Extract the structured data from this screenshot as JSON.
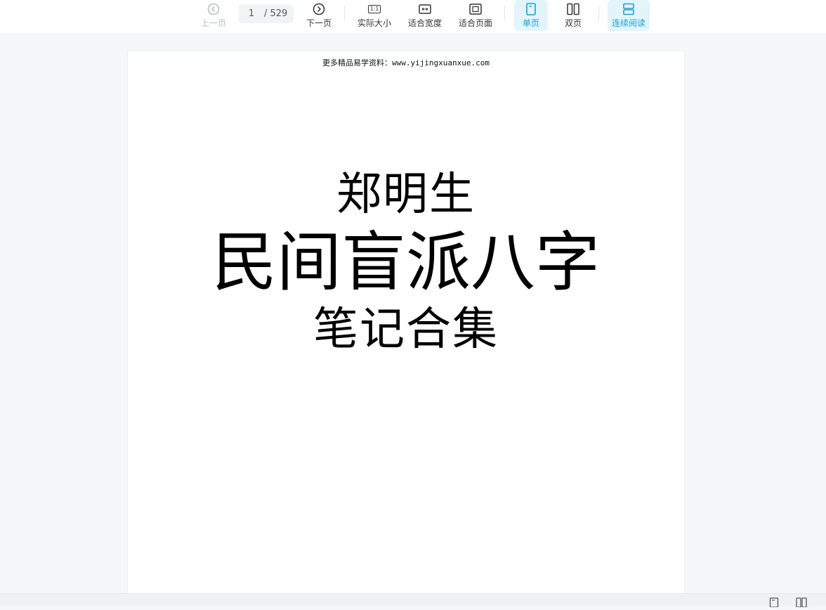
{
  "toolbar": {
    "prev_label": "上一页",
    "next_label": "下一页",
    "page_current": "1",
    "page_total": "/ 529",
    "actual_size_label": "实际大小",
    "fit_width_label": "适合宽度",
    "fit_page_label": "适合页面",
    "single_page_label": "单页",
    "double_page_label": "双页",
    "continuous_label": "连续阅读",
    "actual_size_icon_text": "1:1",
    "accent_color": "#1aa0d8"
  },
  "document": {
    "header_note": "更多精品易学资料：www.yijingxuanxue.com",
    "title_line1": "郑明生",
    "title_line2": "民间盲派八字",
    "title_line3": "笔记合集"
  },
  "statusbar": {
    "icons": [
      "single-page-icon",
      "double-page-icon"
    ]
  }
}
